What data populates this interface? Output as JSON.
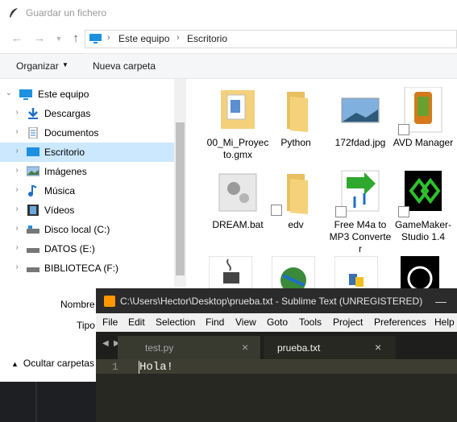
{
  "dialog": {
    "title": "Guardar un fichero",
    "address": [
      "Este equipo",
      "Escritorio"
    ],
    "toolbar": {
      "organize": "Organizar",
      "new_folder": "Nueva carpeta"
    },
    "tree": [
      {
        "label": "Este equipo",
        "icon": "pc-icon",
        "expanded": true
      },
      {
        "label": "Descargas",
        "icon": "download-icon"
      },
      {
        "label": "Documentos",
        "icon": "document-icon"
      },
      {
        "label": "Escritorio",
        "icon": "desktop-icon",
        "selected": true
      },
      {
        "label": "Imágenes",
        "icon": "image-icon"
      },
      {
        "label": "Música",
        "icon": "music-icon"
      },
      {
        "label": "Vídeos",
        "icon": "video-icon"
      },
      {
        "label": "Disco local (C:)",
        "icon": "drive-icon"
      },
      {
        "label": "DATOS (E:)",
        "icon": "drive-icon"
      },
      {
        "label": "BIBLIOTECA (F:)",
        "icon": "drive-icon"
      }
    ],
    "files": [
      {
        "name": "00_Mi_Proyecto.gmx",
        "icon": "folder-doc-icon"
      },
      {
        "name": "Python",
        "icon": "folder-icon"
      },
      {
        "name": "172fdad.jpg",
        "icon": "image-file-icon"
      },
      {
        "name": "AVD Manager",
        "icon": "android-device-icon"
      },
      {
        "name": "DREAM.bat",
        "icon": "batch-file-icon"
      },
      {
        "name": "edv",
        "icon": "folder-icon"
      },
      {
        "name": "Free M4a to MP3 Converter",
        "icon": "converter-icon"
      },
      {
        "name": "GameMaker-Studio 1.4",
        "icon": "gamemaker-icon"
      }
    ],
    "file_name_label": "Nombre",
    "file_type_label": "Tipo",
    "hide_folders": "Ocultar carpetas"
  },
  "sublime": {
    "title": "C:\\Users\\Hector\\Desktop\\prueba.txt - Sublime Text (UNREGISTERED)",
    "minimize": "—",
    "menu": [
      "File",
      "Edit",
      "Selection",
      "Find",
      "View",
      "Goto",
      "Tools",
      "Project",
      "Preferences",
      "Help"
    ],
    "tabs": [
      {
        "label": "test.py",
        "close": "×"
      },
      {
        "label": "prueba.txt",
        "close": "×"
      }
    ],
    "line_number": "1",
    "code": "Hola!"
  }
}
